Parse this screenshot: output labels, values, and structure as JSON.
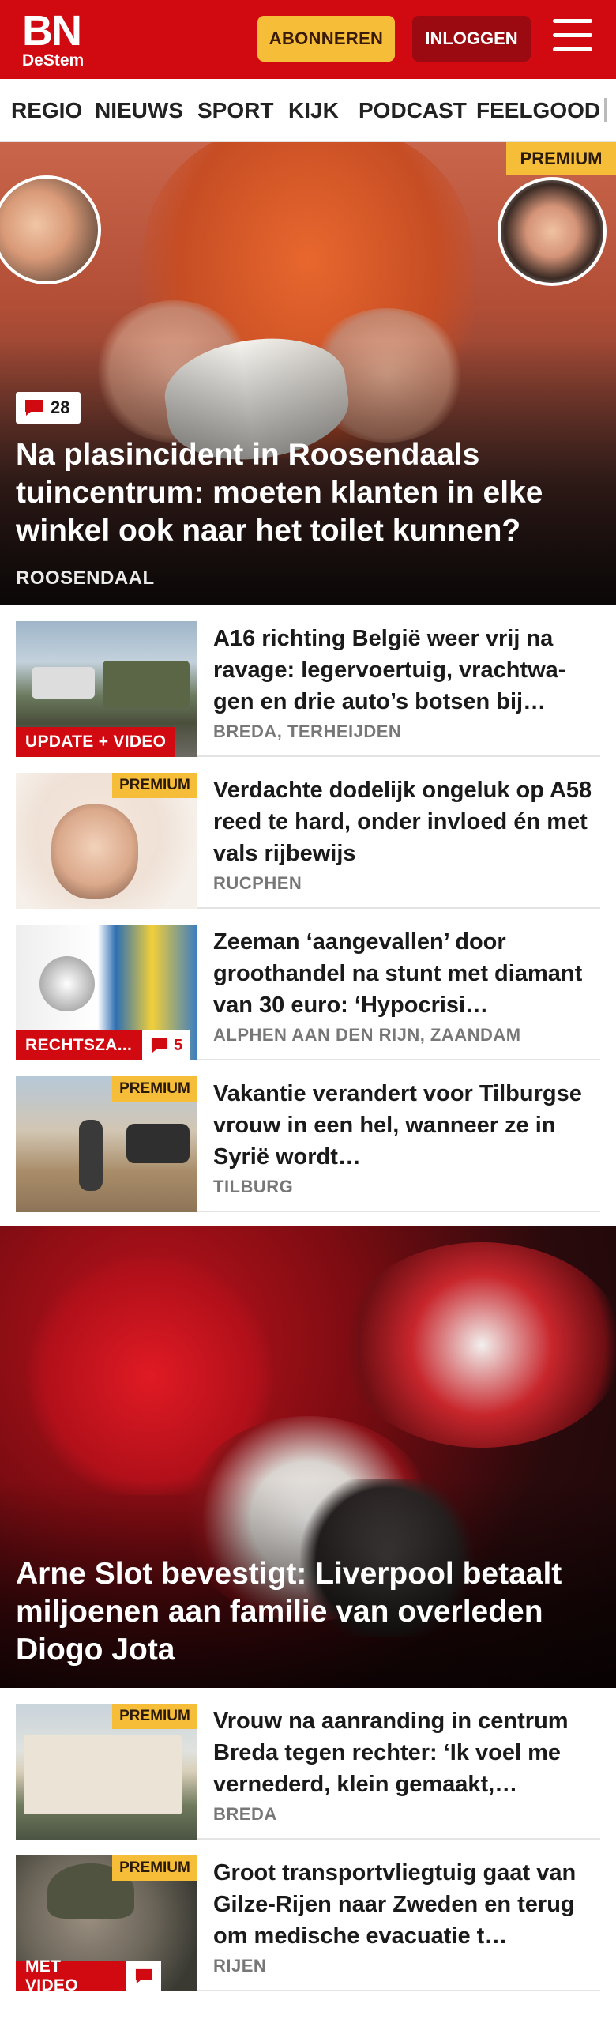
{
  "header": {
    "logo_main": "BN",
    "logo_sub": "DeStem",
    "subscribe_label": "ABONNEREN",
    "login_label": "INLOGGEN"
  },
  "nav": {
    "items": [
      "REGIO",
      "NIEUWS",
      "SPORT",
      "KIJK",
      "PODCAST",
      "FEELGOOD"
    ]
  },
  "hero": {
    "badge": "PREMIUM",
    "comments": "28",
    "title": "Na plasincident in Roosendaals tuincentrum: moeten klanten in elke winkel ook naar het toilet kunnen?",
    "location": "ROOSENDAAL"
  },
  "articles": [
    {
      "label": "UPDATE + VIDEO",
      "title": "A16 richting België weer vrij na ravage: legervoertuig, vrachtwa-gen en drie auto’s botsen bij…",
      "location": "BREDA, TERHEIJDEN"
    },
    {
      "badge": "PREMIUM",
      "title": "Verdachte dodelijk ongeluk op A58 reed te hard, onder invloed én met vals rijbewijs",
      "location": "RUCPHEN"
    },
    {
      "label": "RECHTSZA...",
      "comments": "5",
      "title": "Zeeman ‘aangevallen’ door groothandel na stunt met diamant van 30 euro: ‘Hypocrisi…",
      "location": "ALPHEN AAN DEN RIJN, ZAANDAM"
    },
    {
      "badge": "PREMIUM",
      "title": "Vakantie verandert voor Tilburgse vrouw in een hel, wanneer ze in Syrië wordt…",
      "location": "TILBURG"
    }
  ],
  "feature": {
    "title": "Arne Slot bevestigt: Liverpool betaalt miljoenen aan familie van overleden Diogo Jota"
  },
  "articles2": [
    {
      "badge": "PREMIUM",
      "title": "Vrouw na aanranding in centrum Breda tegen rechter: ‘Ik voel me vernederd, klein gemaakt,…",
      "location": "BREDA"
    },
    {
      "badge": "PREMIUM",
      "label": "MET VIDEO",
      "title": "Groot transportvliegtuig gaat van Gilze-Rijen naar Zweden en terug om medische evacuatie t…",
      "location": "RIJEN"
    }
  ],
  "colors": {
    "brand_red": "#d10a11",
    "premium_yellow": "#f6bd38",
    "login_dark_red": "#9b0a10"
  },
  "icons": [
    "menu-icon",
    "comment-icon"
  ]
}
